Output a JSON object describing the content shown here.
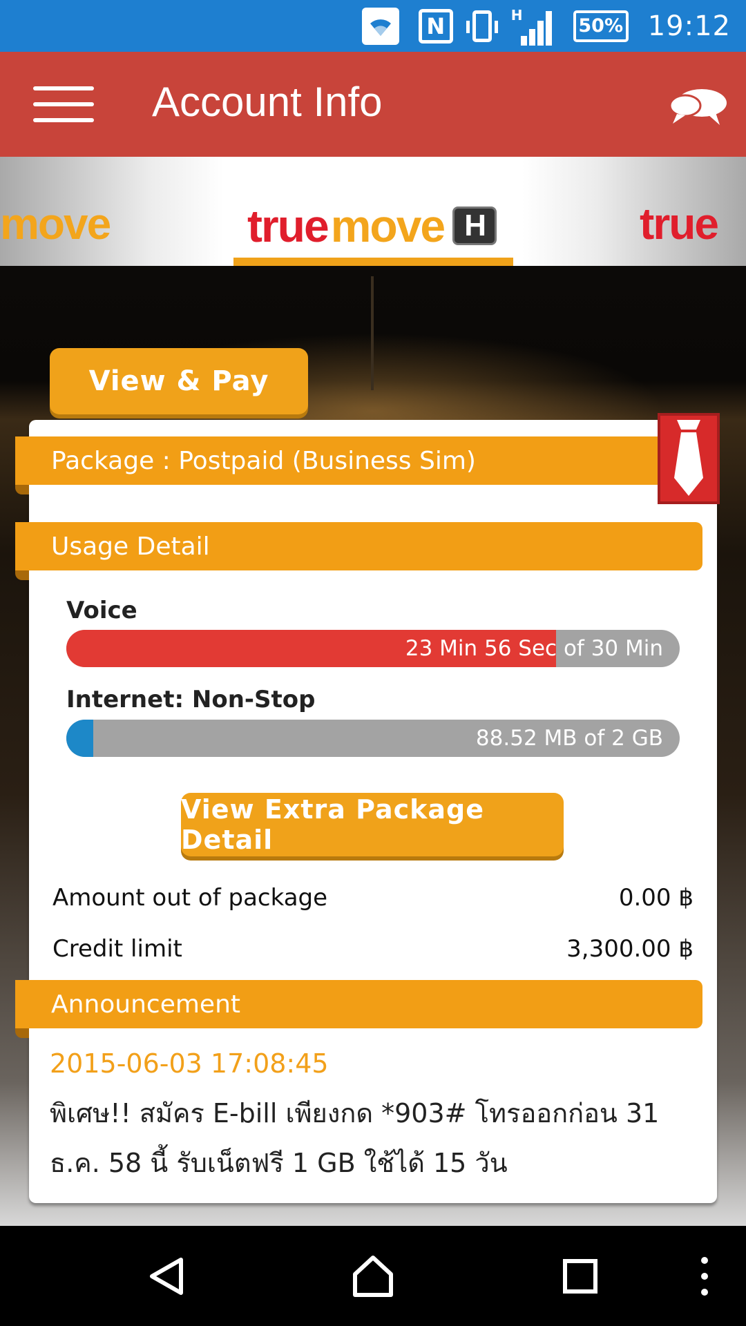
{
  "status_bar": {
    "battery": "50%",
    "time": "19:12",
    "network_type": "H"
  },
  "app_bar": {
    "title": "Account Info"
  },
  "carousel": {
    "left_text": "move",
    "center_text_true": "true",
    "center_text_move": "move",
    "center_badge": "H",
    "right_text": "true"
  },
  "actions": {
    "view_pay": "View & Pay",
    "view_extra": "View Extra Package Detail"
  },
  "package": {
    "label": "Package : Postpaid (Business Sim)"
  },
  "usage": {
    "header": "Usage Detail",
    "voice": {
      "label": "Voice",
      "text": "23 Min 56 Sec of 30 Min",
      "fraction": 0.798
    },
    "internet": {
      "label": "Internet: Non-Stop",
      "text": "88.52 MB of 2 GB",
      "fraction": 0.044
    }
  },
  "amounts": {
    "out_of_package_label": "Amount out of package",
    "out_of_package_value": "0.00 ฿",
    "credit_limit_label": "Credit limit",
    "credit_limit_value": "3,300.00 ฿"
  },
  "announcement": {
    "header": "Announcement",
    "date": "2015-06-03 17:08:45",
    "text": "พิเศษ!! สมัคร E-bill เพียงกด *903# โทรออกก่อน 31 ธ.ค. 58 นี้ รับเน็ตฟรี 1 GB ใช้ได้ 15 วัน"
  },
  "colors": {
    "status_bar": "#1e7fd0",
    "app_bar": "#c8443a",
    "accent_orange": "#f29e15",
    "voice_fill": "#e23a34",
    "internet_fill": "#1d88c8",
    "track": "#a3a3a3",
    "date_text": "#f2a01a"
  },
  "icons": {
    "menu": "hamburger-menu-icon",
    "chat": "chat-bubble-icon",
    "badge": "necktie-icon",
    "nav_back": "back-triangle-icon",
    "nav_home": "home-icon",
    "nav_recents": "recents-square-icon",
    "nav_more": "overflow-dots-icon"
  }
}
